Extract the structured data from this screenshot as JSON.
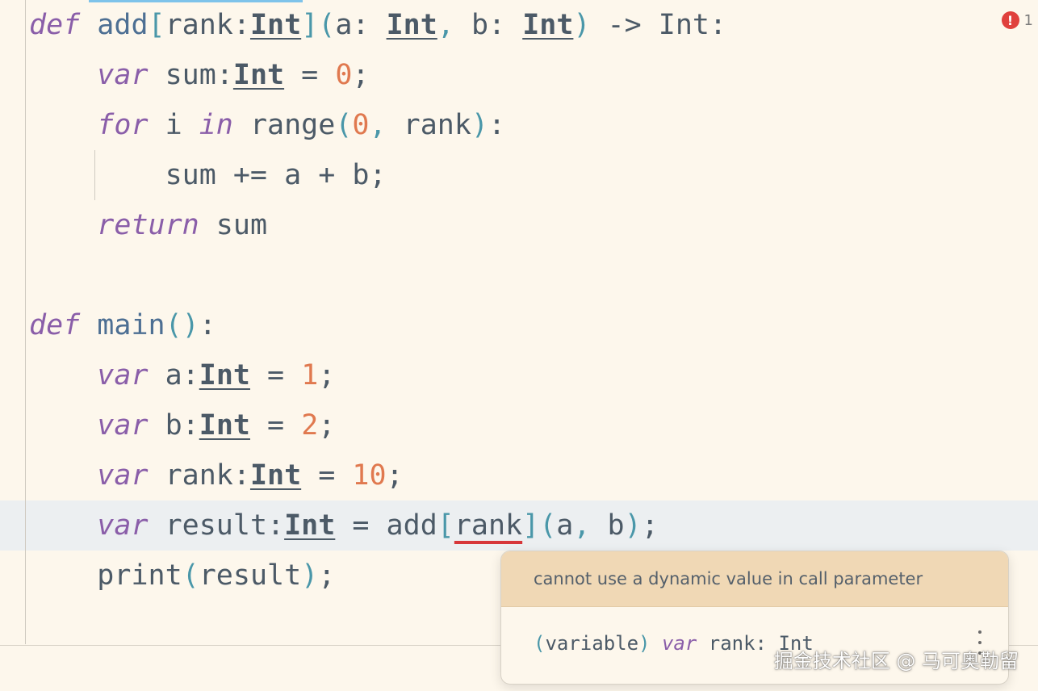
{
  "problems": {
    "count": "1"
  },
  "code": {
    "l1": {
      "def": "def",
      "name": "add",
      "lb": "[",
      "p0": "rank",
      "c0": ":",
      "t0": "Int",
      "rb": "]",
      "lp": "(",
      "p1": "a",
      "c1": ": ",
      "t1": "Int",
      "comma": ",",
      "p2": " b",
      "c2": ": ",
      "t2": "Int",
      "rp": ")",
      "arrow": " -> ",
      "ret": "Int",
      "colon": ":"
    },
    "l2": {
      "indent": "    ",
      "var": "var",
      "name": " sum",
      "colon": ":",
      "type": "Int",
      "eq": " = ",
      "val": "0",
      "semi": ";"
    },
    "l3": {
      "indent": "    ",
      "for": "for",
      "i": " i ",
      "in": "in",
      "range": " range",
      "lp": "(",
      "a0": "0",
      "comma": ",",
      "a1": " rank",
      "rp": ")",
      "colon": ":"
    },
    "l4": {
      "indent": "        ",
      "text": "sum += a + b;"
    },
    "l5": {
      "indent": "    ",
      "ret": "return",
      "val": " sum"
    },
    "l6": {
      "def": "def",
      "name": "main",
      "parens": "()",
      "colon": ":"
    },
    "l7": {
      "indent": "    ",
      "var": "var",
      "name": " a",
      "colon": ":",
      "type": "Int",
      "eq": " = ",
      "val": "1",
      "semi": ";"
    },
    "l8": {
      "indent": "    ",
      "var": "var",
      "name": " b",
      "colon": ":",
      "type": "Int",
      "eq": " = ",
      "val": "2",
      "semi": ";"
    },
    "l9": {
      "indent": "    ",
      "var": "var",
      "name": " rank",
      "colon": ":",
      "type": "Int",
      "eq": " = ",
      "val": "10",
      "semi": ";"
    },
    "l10": {
      "indent": "    ",
      "var": "var",
      "name": " result",
      "colon": ":",
      "type": "Int",
      "eq": " = ",
      "fn": "add",
      "lb": "[",
      "arg": "rank",
      "rb": "]",
      "lp": "(",
      "a": "a",
      "comma": ",",
      "b": " b",
      "rp": ")",
      "semi": ";"
    },
    "l11": {
      "indent": "    ",
      "fn": "print",
      "lp": "(",
      "arg": "result",
      "rp": ")",
      "semi": ";"
    }
  },
  "hover": {
    "message": "cannot use a dynamic value in call parameter",
    "sig_lp": "(",
    "sig_kind": "variable",
    "sig_rp": ")",
    "sig_var": " var",
    "sig_rest": " rank: Int"
  },
  "watermark": "掘金技术社区 @ 马可奥勒留"
}
